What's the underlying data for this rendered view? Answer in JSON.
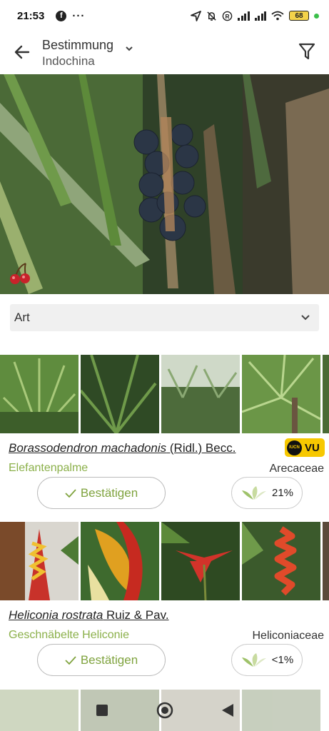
{
  "status_bar": {
    "time": "21:53",
    "facebook_icon": "f",
    "overflow": "···",
    "battery": "68",
    "icons": [
      "location-arrow-icon",
      "alarm-off-icon",
      "registered-icon",
      "signal-icon",
      "signal-icon",
      "wifi-icon",
      "battery-icon",
      "green-dot-icon"
    ]
  },
  "app_bar": {
    "title": "Bestimmung",
    "subtitle": "Indochina",
    "icons": [
      "back-arrow-icon",
      "chevron-down-icon",
      "filter-icon"
    ]
  },
  "hero": {
    "badge_icon": "cherry-icon"
  },
  "rank_dropdown": {
    "value": "Art"
  },
  "results": [
    {
      "genus_species": "Borassodendron machadonis",
      "author": " (Ridl.) Becc.",
      "common_name": "Elefantenpalme",
      "family": "Arecaceae",
      "confirm_label": "Bestätigen",
      "score": "21%",
      "iucn": {
        "logo": "IUCN",
        "category": "VU"
      }
    },
    {
      "genus_species": "Heliconia rostrata",
      "author": " Ruiz & Pav.",
      "common_name": "Geschnäbelte Heliconie",
      "family": "Heliconiaceae",
      "confirm_label": "Bestätigen",
      "score": "<1%"
    }
  ],
  "colors": {
    "accent_green": "#8bb04a",
    "iucn_yellow": "#f7c800"
  }
}
